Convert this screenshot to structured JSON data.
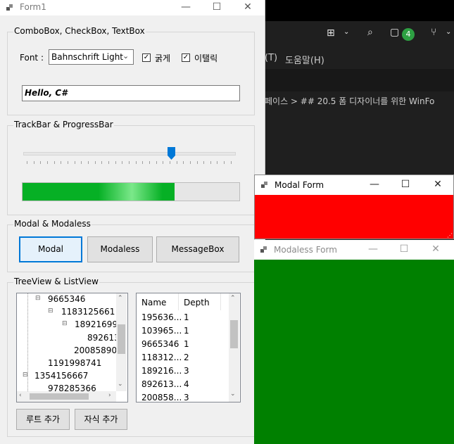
{
  "ide": {
    "menu_partial": "(T)",
    "menu_help": "도움말(H)",
    "badge_count": "4",
    "breadcrumb": "페이스 > ## 20.5 폼 디자이너를 위한 WinFo"
  },
  "form1": {
    "title": "Form1",
    "combo_group": {
      "label": "ComboBox, CheckBox, TextBox",
      "font_label": "Font :",
      "font_value": "Bahnschrift Light",
      "bold_label": "굵게",
      "italic_label": "이탤릭",
      "text_value": "Hello, C#"
    },
    "track_group": {
      "label": "TrackBar & ProgressBar",
      "trackbar_value": 0.7,
      "progress_value": 0.7
    },
    "modal_group": {
      "label": "Modal & Modaless",
      "modal_btn": "Modal",
      "modaless_btn": "Modaless",
      "messagebox_btn": "MessageBox"
    },
    "tree_group": {
      "label": "TreeView & ListView",
      "tree_nodes": [
        "9665346",
        "1183125661",
        "18921699",
        "892613",
        "20085890",
        "1191998741",
        "1354156667",
        "978285366"
      ],
      "list_headers": [
        "Name",
        "Depth"
      ],
      "list_rows": [
        {
          "name": "195636...",
          "depth": "1"
        },
        {
          "name": "103965...",
          "depth": "1"
        },
        {
          "name": "9665346",
          "depth": "1"
        },
        {
          "name": "118312...",
          "depth": "2"
        },
        {
          "name": "189216...",
          "depth": "3"
        },
        {
          "name": "892613...",
          "depth": "4"
        },
        {
          "name": "200858...",
          "depth": "3"
        }
      ],
      "add_root_btn": "루트 추가",
      "add_child_btn": "자식 추가"
    }
  },
  "modal_form": {
    "title": "Modal Form",
    "bg": "#ff0000"
  },
  "modaless_form": {
    "title": "Modaless Form",
    "bg": "#008000"
  }
}
